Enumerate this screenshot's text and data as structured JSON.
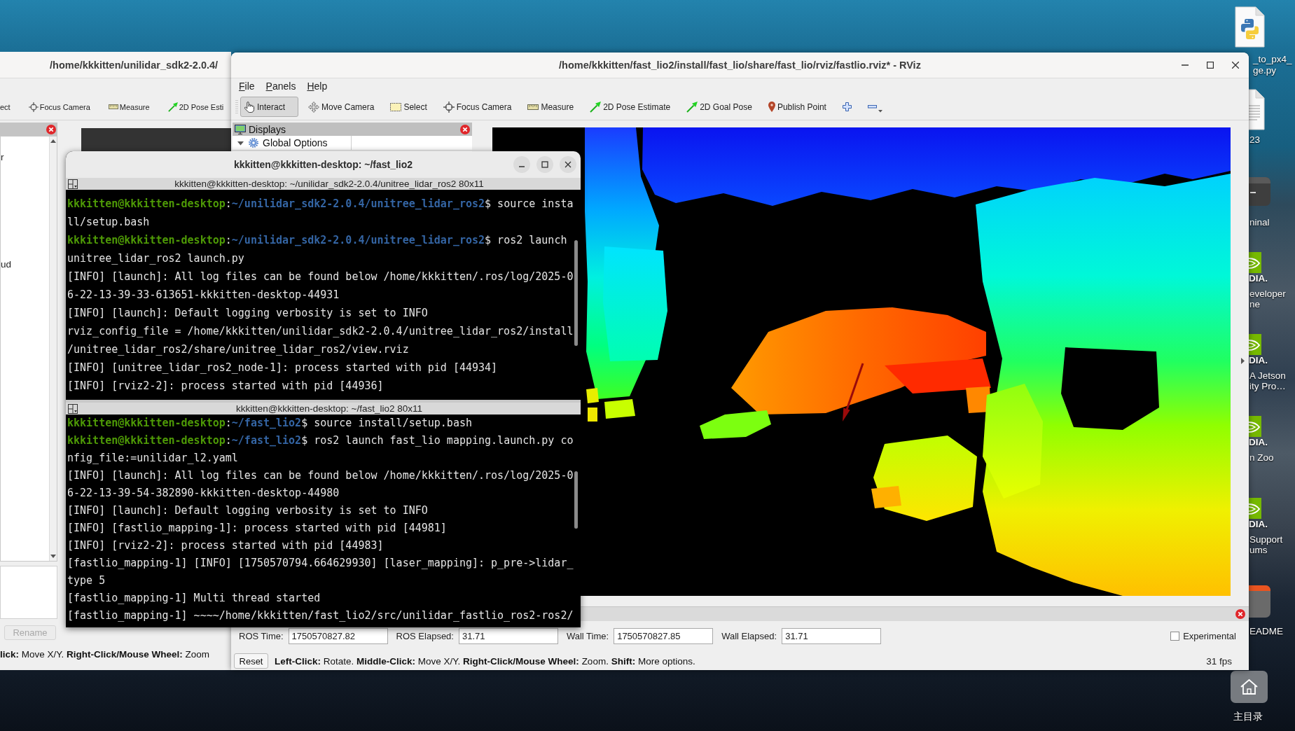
{
  "background_window": {
    "title": "/home/kkkitten/unilidar_sdk2-2.0.4/",
    "tools": [
      {
        "kind": "none",
        "label": "ect"
      },
      {
        "kind": "focus",
        "label": "Focus Camera"
      },
      {
        "kind": "measure",
        "label": "Measure"
      },
      {
        "kind": "pose",
        "label": "2D Pose Esti"
      }
    ],
    "list_fragments": [
      "r",
      "ud"
    ],
    "rename_button": {
      "label": "Rename",
      "disabled": true
    },
    "status": "**lick:** Move X/Y. **Right-Click/Mouse Wheel:** Zoom"
  },
  "rviz": {
    "title": "/home/kkkitten/fast_lio2/install/fast_lio/share/fast_lio/rviz/fastlio.rviz* - RViz",
    "menu": [
      "File",
      "Panels",
      "Help"
    ],
    "tools": [
      {
        "kind": "interact",
        "label": "Interact",
        "selected": true
      },
      {
        "kind": "move",
        "label": "Move Camera",
        "selected": false
      },
      {
        "kind": "select",
        "label": "Select",
        "selected": false
      },
      {
        "kind": "focus",
        "label": "Focus Camera",
        "selected": false
      },
      {
        "kind": "measure",
        "label": "Measure",
        "selected": false
      },
      {
        "kind": "pose",
        "label": "2D Pose Estimate",
        "selected": false
      },
      {
        "kind": "goal",
        "label": "2D Goal Pose",
        "selected": false
      },
      {
        "kind": "point",
        "label": "Publish Point",
        "selected": false
      },
      {
        "kind": "add",
        "selected": false
      },
      {
        "kind": "remove",
        "selected": false
      }
    ],
    "displays": {
      "title": "Displays",
      "items": [
        {
          "label": "Global Options",
          "expanded": true
        }
      ]
    },
    "time_fields": [
      {
        "label": "ROS Time:",
        "value": "1750570827.82"
      },
      {
        "label": "ROS Elapsed:",
        "value": "31.71"
      },
      {
        "label": "Wall Time:",
        "value": "1750570827.85"
      },
      {
        "label": "Wall Elapsed:",
        "value": "31.71"
      }
    ],
    "experimental": {
      "label": "Experimental",
      "checked": false
    },
    "status": {
      "reset_button": "Reset",
      "hint": "**Left-Click:** Rotate. **Middle-Click:** Move X/Y. **Right-Click/Mouse Wheel:** Zoom. **Shift:** More options.",
      "fps": "31 fps"
    }
  },
  "terminal": {
    "title": "kkkitten@kkkitten-desktop: ~/fast_lio2",
    "panes": [
      {
        "header": "kkkitten@kkkitten-desktop: ~/unilidar_sdk2-2.0.4/unitree_lidar_ros2 80x11",
        "lines": [
          {
            "kind": "prompt",
            "segments": [
              {
                "kind": "user",
                "text": "kkkitten@kkkitten-desktop"
              },
              {
                "kind": "plain",
                "text": ":"
              },
              {
                "kind": "path",
                "text": "~/unilidar_sdk2-2.0.4/unitree_lidar_ros2"
              },
              {
                "kind": "plain",
                "text": "$ source insta"
              }
            ]
          },
          {
            "kind": "output",
            "text": "ll/setup.bash"
          },
          {
            "kind": "prompt",
            "segments": [
              {
                "kind": "user",
                "text": "kkkitten@kkkitten-desktop"
              },
              {
                "kind": "plain",
                "text": ":"
              },
              {
                "kind": "path",
                "text": "~/unilidar_sdk2-2.0.4/unitree_lidar_ros2"
              },
              {
                "kind": "plain",
                "text": "$ ros2 launch"
              }
            ]
          },
          {
            "kind": "output",
            "text": "unitree_lidar_ros2 launch.py"
          },
          {
            "kind": "output",
            "text": "[INFO] [launch]: All log files can be found below /home/kkkitten/.ros/log/2025-0"
          },
          {
            "kind": "output",
            "text": "6-22-13-39-33-613651-kkkitten-desktop-44931"
          },
          {
            "kind": "output",
            "text": "[INFO] [launch]: Default logging verbosity is set to INFO"
          },
          {
            "kind": "output",
            "text": "rviz_config_file = /home/kkkitten/unilidar_sdk2-2.0.4/unitree_lidar_ros2/install"
          },
          {
            "kind": "output",
            "text": "/unitree_lidar_ros2/share/unitree_lidar_ros2/view.rviz"
          },
          {
            "kind": "output",
            "text": "[INFO] [unitree_lidar_ros2_node-1]: process started with pid [44934]"
          },
          {
            "kind": "output",
            "text": "[INFO] [rviz2-2]: process started with pid [44936]"
          }
        ]
      },
      {
        "header": "kkkitten@kkkitten-desktop: ~/fast_lio2 80x11",
        "lines": [
          {
            "kind": "prompt",
            "segments": [
              {
                "kind": "user",
                "text": "kkkitten@kkkitten-desktop"
              },
              {
                "kind": "plain",
                "text": ":"
              },
              {
                "kind": "path",
                "text": "~/fast_lio2"
              },
              {
                "kind": "plain",
                "text": "$ source install/setup.bash"
              }
            ]
          },
          {
            "kind": "prompt",
            "segments": [
              {
                "kind": "user",
                "text": "kkkitten@kkkitten-desktop"
              },
              {
                "kind": "plain",
                "text": ":"
              },
              {
                "kind": "path",
                "text": "~/fast_lio2"
              },
              {
                "kind": "plain",
                "text": "$ ros2 launch fast_lio mapping.launch.py co"
              }
            ]
          },
          {
            "kind": "output",
            "text": "nfig_file:=unilidar_l2.yaml"
          },
          {
            "kind": "output",
            "text": "[INFO] [launch]: All log files can be found below /home/kkkitten/.ros/log/2025-0"
          },
          {
            "kind": "output",
            "text": "6-22-13-39-54-382890-kkkitten-desktop-44980"
          },
          {
            "kind": "output",
            "text": "[INFO] [launch]: Default logging verbosity is set to INFO"
          },
          {
            "kind": "output",
            "text": "[INFO] [fastlio_mapping-1]: process started with pid [44981]"
          },
          {
            "kind": "output",
            "text": "[INFO] [rviz2-2]: process started with pid [44983]"
          },
          {
            "kind": "output",
            "text": "[fastlio_mapping-1] [INFO] [1750570794.664629930] [laser_mapping]: p_pre->lidar_"
          },
          {
            "kind": "output",
            "text": "type 5"
          },
          {
            "kind": "output",
            "text": "[fastlio_mapping-1] Multi thread started"
          },
          {
            "kind": "output",
            "text": "[fastlio_mapping-1] ~~~~/home/kkkitten/fast_lio2/src/unilidar_fastlio_ros2-ros2/"
          }
        ]
      }
    ]
  },
  "desktop_icons": [
    {
      "kind": "python",
      "label_lines": [
        "_to_px4_",
        "ge.py"
      ]
    },
    {
      "kind": "text",
      "label_lines": [
        "23"
      ]
    },
    {
      "kind": "terminal",
      "label_lines": [
        "ninal"
      ]
    },
    {
      "kind": "nvidia",
      "logo_text": "DIA.",
      "label_lines": [
        "eveloper",
        "ne"
      ]
    },
    {
      "kind": "nvidia",
      "logo_text": "DIA.",
      "label_lines": [
        "A Jetson",
        "ity Pro…"
      ]
    },
    {
      "kind": "nvidia",
      "logo_text": "DIA.",
      "label_lines": [
        "n Zoo"
      ]
    },
    {
      "kind": "nvidia",
      "logo_text": "DIA.",
      "label_lines": [
        "Support",
        "ums"
      ]
    },
    {
      "kind": "readme",
      "label_lines": [
        "EADME"
      ]
    },
    {
      "kind": "home",
      "label_lines": [
        "主目录"
      ]
    }
  ]
}
